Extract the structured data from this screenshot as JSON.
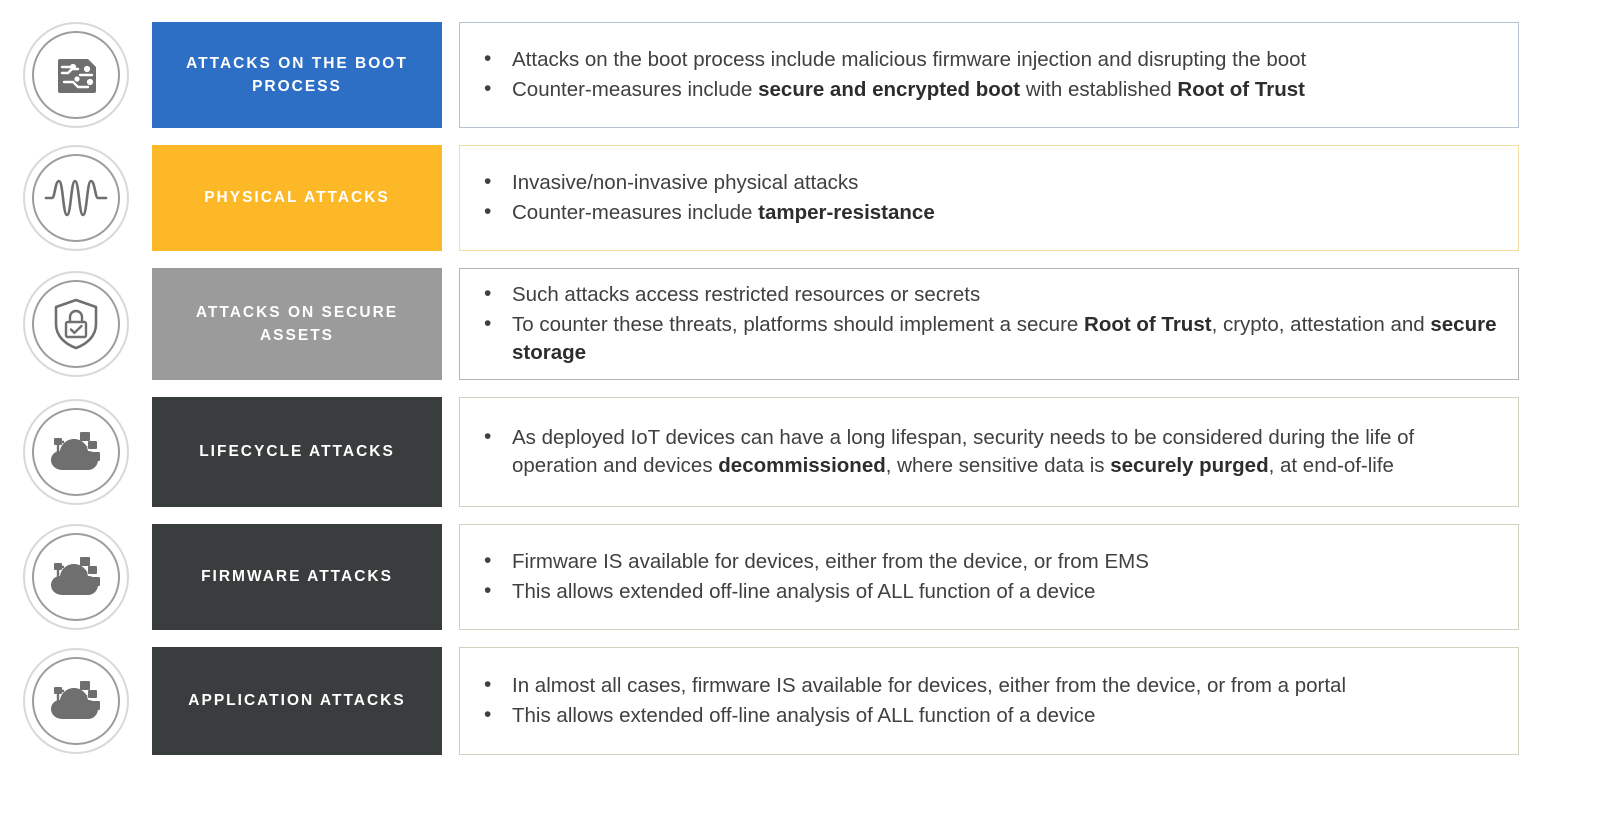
{
  "colors": {
    "blue": "#2e6fc6",
    "orange": "#fdb827",
    "gray": "#9b9b9b",
    "dark": "#3a3d3e",
    "border_blue": "#b8c2d0",
    "border_yellow": "#f3dda4",
    "border_gray": "#b5b5b5",
    "border_olive": "#cfd3bd",
    "icon_fill": "#6f6f6f",
    "text": "#404040"
  },
  "rows": [
    {
      "icon": "circuit-board-icon",
      "label": "ATTACKS ON THE BOOT PROCESS",
      "label_bg": "#2e6fc6",
      "label_color": "#ffffff",
      "box_border": "#b8c2d0",
      "bullets": [
        [
          {
            "text": "Attacks on the boot process include malicious firmware injection and disrupting the boot",
            "bold": false
          }
        ],
        [
          {
            "text": "Counter-measures include ",
            "bold": false
          },
          {
            "text": "secure and encrypted boot",
            "bold": true
          },
          {
            "text": " with established ",
            "bold": false
          },
          {
            "text": "Root of Trust",
            "bold": true
          }
        ]
      ]
    },
    {
      "icon": "waveform-icon",
      "label": "PHYSICAL ATTACKS",
      "label_bg": "#fdb827",
      "label_color": "#ffffff",
      "box_border": "#f3dda4",
      "bullets": [
        [
          {
            "text": "Invasive/non-invasive physical attacks",
            "bold": false
          }
        ],
        [
          {
            "text": "Counter-measures include ",
            "bold": false
          },
          {
            "text": "tamper-resistance",
            "bold": true
          }
        ]
      ]
    },
    {
      "icon": "shield-lock-icon",
      "label": "ATTACKS ON SECURE ASSETS",
      "label_bg": "#9b9b9b",
      "label_color": "#ffffff",
      "box_border": "#b5b5b5",
      "bullets": [
        [
          {
            "text": "Such attacks access restricted resources or secrets",
            "bold": false
          }
        ],
        [
          {
            "text": "To counter these threats, platforms should implement a secure ",
            "bold": false
          },
          {
            "text": "Root of Trust",
            "bold": true
          },
          {
            "text": ", crypto, attestation and ",
            "bold": false
          },
          {
            "text": "secure storage",
            "bold": true
          }
        ]
      ]
    },
    {
      "icon": "cloud-network-icon",
      "label": "LIFECYCLE ATTACKS",
      "label_bg": "#3a3d3e",
      "label_color": "#ffffff",
      "box_border": "#cfd3bd",
      "bullets": [
        [
          {
            "text": "As deployed IoT devices can have a long lifespan, security needs to be considered during the life of operation and devices ",
            "bold": false
          },
          {
            "text": "decommissioned",
            "bold": true
          },
          {
            "text": ", where sensitive data is ",
            "bold": false
          },
          {
            "text": "securely purged",
            "bold": true
          },
          {
            "text": ", at end-of-life",
            "bold": false
          }
        ]
      ]
    },
    {
      "icon": "cloud-network-icon",
      "label": "FIRMWARE ATTACKS",
      "label_bg": "#3a3d3e",
      "label_color": "#ffffff",
      "box_border": "#cfd3bd",
      "bullets": [
        [
          {
            "text": "Firmware IS available for devices, either from the device, or from EMS",
            "bold": false
          }
        ],
        [
          {
            "text": "This allows extended off-line analysis of ALL function of a device",
            "bold": false
          }
        ]
      ]
    },
    {
      "icon": "cloud-network-icon",
      "label": "APPLICATION ATTACKS",
      "label_bg": "#3a3d3e",
      "label_color": "#ffffff",
      "box_border": "#cfd3bd",
      "bullets": [
        [
          {
            "text": "In almost all cases, firmware IS available for devices, either from the device, or from a portal",
            "bold": false
          }
        ],
        [
          {
            "text": "This allows extended off-line analysis of ALL function of a device",
            "bold": false
          }
        ]
      ]
    }
  ]
}
